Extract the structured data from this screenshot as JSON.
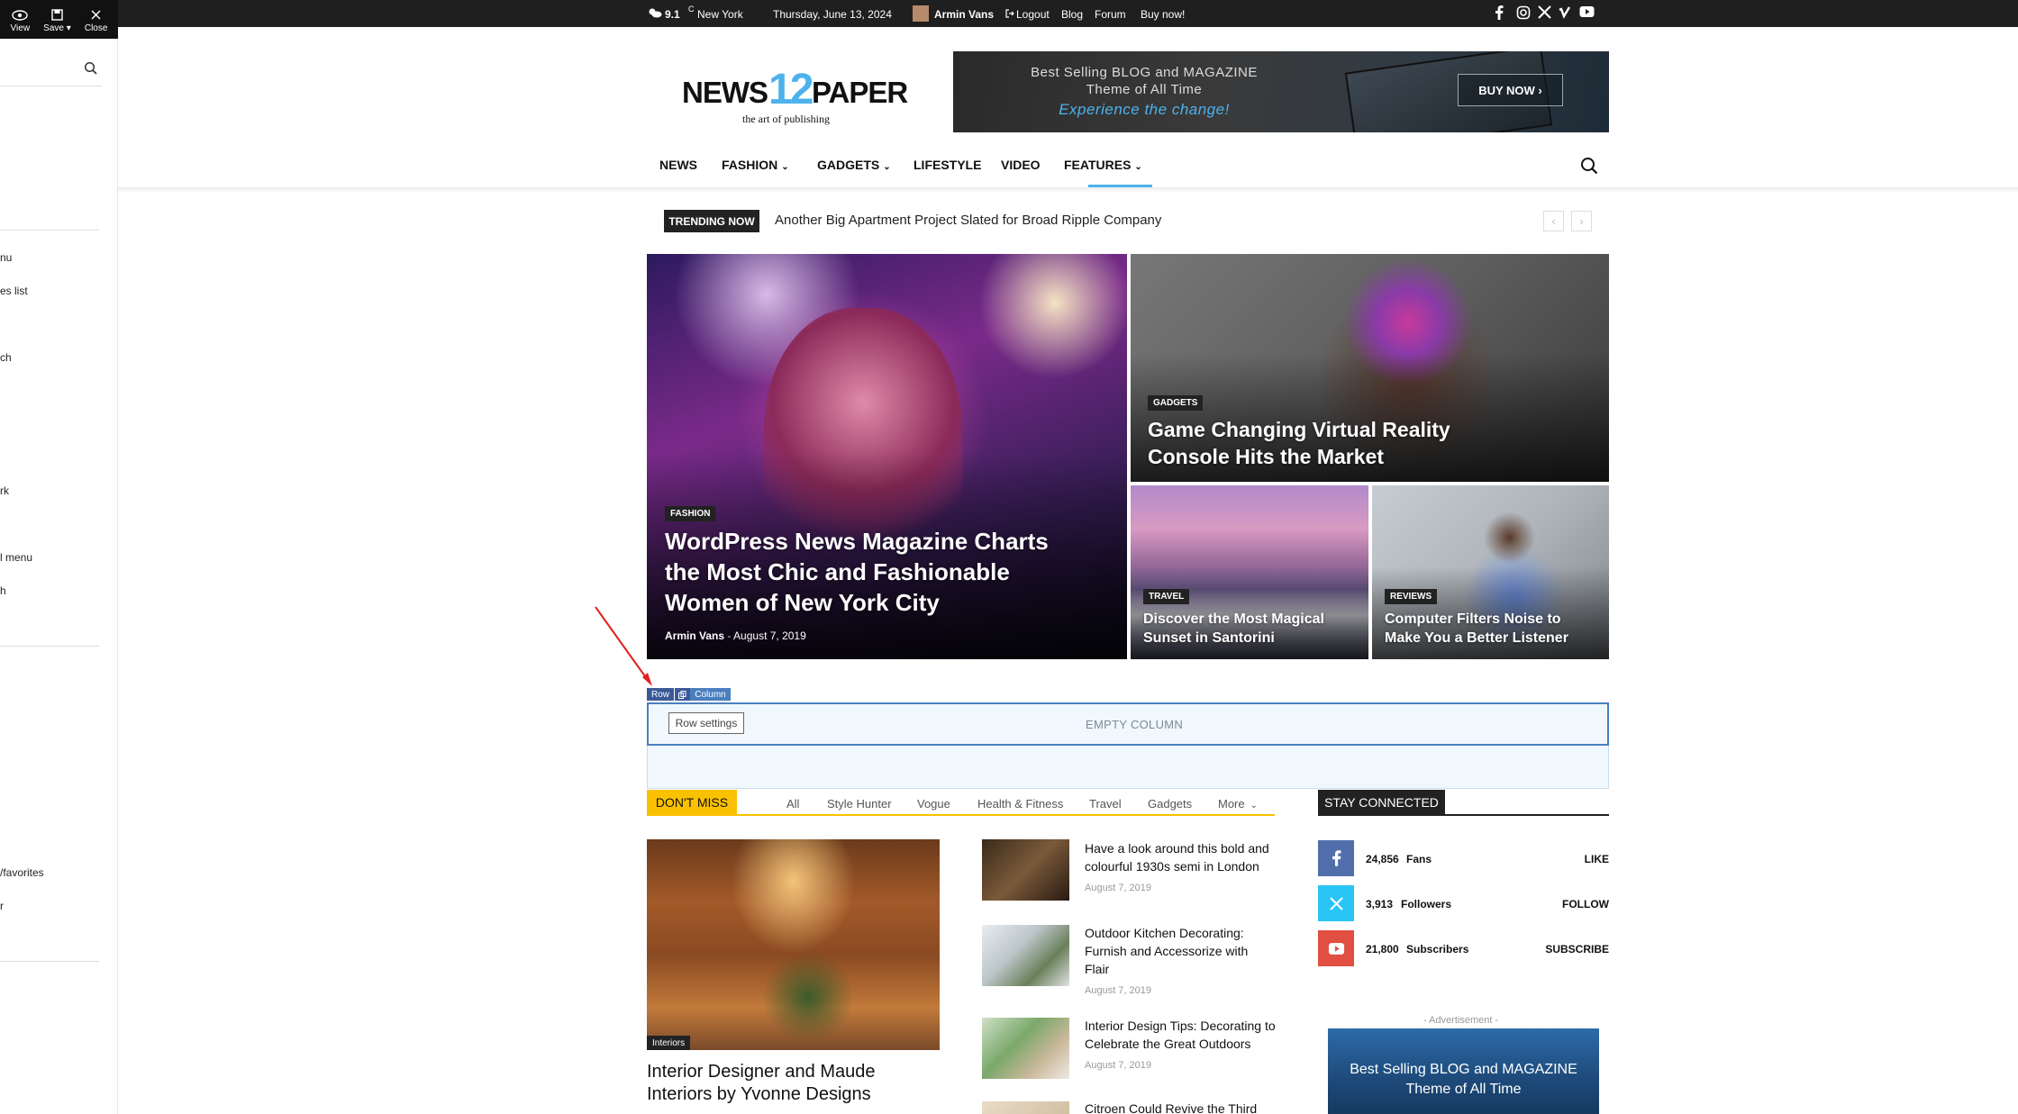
{
  "editor": {
    "toolbar": {
      "view": "View",
      "save": "Save ▾",
      "close": "Close"
    },
    "items": [
      "nu",
      "es list",
      "ch",
      "rk",
      "l menu",
      "h",
      "/favorites",
      "r"
    ]
  },
  "topbar": {
    "temp": "9.1",
    "unit": "C",
    "city": "New York",
    "date": "Thursday, June 13, 2024",
    "user": "Armin Vans",
    "logout": "Logout",
    "links": [
      "Blog",
      "Forum",
      "Buy now!"
    ]
  },
  "logo": {
    "news": "NEWS",
    "num": "12",
    "paper": "PAPER",
    "tagline": "the art of publishing"
  },
  "banner": {
    "line1": "Best Selling BLOG and MAGAZINE",
    "line2": "Theme of All Time",
    "line3": "Experience the change!",
    "button": "BUY NOW ›"
  },
  "nav": {
    "items": [
      "NEWS",
      "FASHION",
      "GADGETS",
      "LIFESTYLE",
      "VIDEO",
      "FEATURES"
    ]
  },
  "trending": {
    "label": "TRENDING NOW",
    "headline": "Another Big Apartment Project Slated for Broad Ripple Company"
  },
  "grid": {
    "main": {
      "category": "FASHION",
      "title": "WordPress News Magazine Charts the Most Chic and Fashionable Women of New York City",
      "author": "Armin Vans",
      "date": "August 7, 2019"
    },
    "vr": {
      "category": "GADGETS",
      "title": "Game Changing Virtual Reality Console Hits the Market"
    },
    "travel": {
      "category": "TRAVEL",
      "title": "Discover the Most Magical Sunset in Santorini"
    },
    "review": {
      "category": "REVIEWS",
      "title": "Computer Filters Noise to Make You a Better Listener"
    }
  },
  "builder": {
    "row": "Row",
    "column": "Column",
    "row_settings": "Row settings",
    "empty": "EMPTY COLUMN"
  },
  "dont_miss": {
    "label": "DON'T MISS",
    "tabs": [
      "All",
      "Style Hunter",
      "Vogue",
      "Health & Fitness",
      "Travel",
      "Gadgets",
      "More"
    ],
    "big": {
      "category": "Interiors",
      "title": "Interior Designer and Maude Interiors by Yvonne Designs"
    },
    "small": [
      {
        "title": "Have a look around this bold and colourful 1930s semi in London",
        "date": "August 7, 2019"
      },
      {
        "title": "Outdoor Kitchen Decorating: Furnish and Accessorize with Flair",
        "date": "August 7, 2019"
      },
      {
        "title": "Interior Design Tips: Decorating to Celebrate the Great Outdoors",
        "date": "August 7, 2019"
      },
      {
        "title": "Citroen Could Revive the Third"
      }
    ]
  },
  "stay_connected": {
    "label": "STAY CONNECTED",
    "rows": [
      {
        "count": "24,856",
        "label": "Fans",
        "action": "LIKE",
        "color": "#516eab"
      },
      {
        "count": "3,913",
        "label": "Followers",
        "action": "FOLLOW",
        "color": "#29c5f6"
      },
      {
        "count": "21,800",
        "label": "Subscribers",
        "action": "SUBSCRIBE",
        "color": "#e14e42"
      }
    ],
    "ad_label": "- Advertisement -",
    "ad_line1": "Best Selling BLOG and MAGAZINE",
    "ad_line2": "Theme of All Time"
  },
  "colors": {
    "accent": "#4db2ec",
    "dont_miss": "#f9c100",
    "builder": "#4a7fbf"
  }
}
